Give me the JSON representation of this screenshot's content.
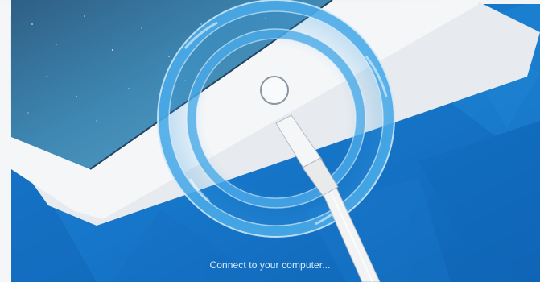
{
  "screen": {
    "status_text": "Connect to your computer...",
    "background_color": "#1778cc",
    "accent_color": "#4aaae8"
  },
  "device": {
    "type": "tablet",
    "frame_color": "#eef1f4",
    "wallpaper": "starry-blue-sky"
  },
  "icons": {
    "home_button": "home-button-icon",
    "cable": "lightning-cable-icon",
    "connection_rings": "connection-rings-icon"
  }
}
